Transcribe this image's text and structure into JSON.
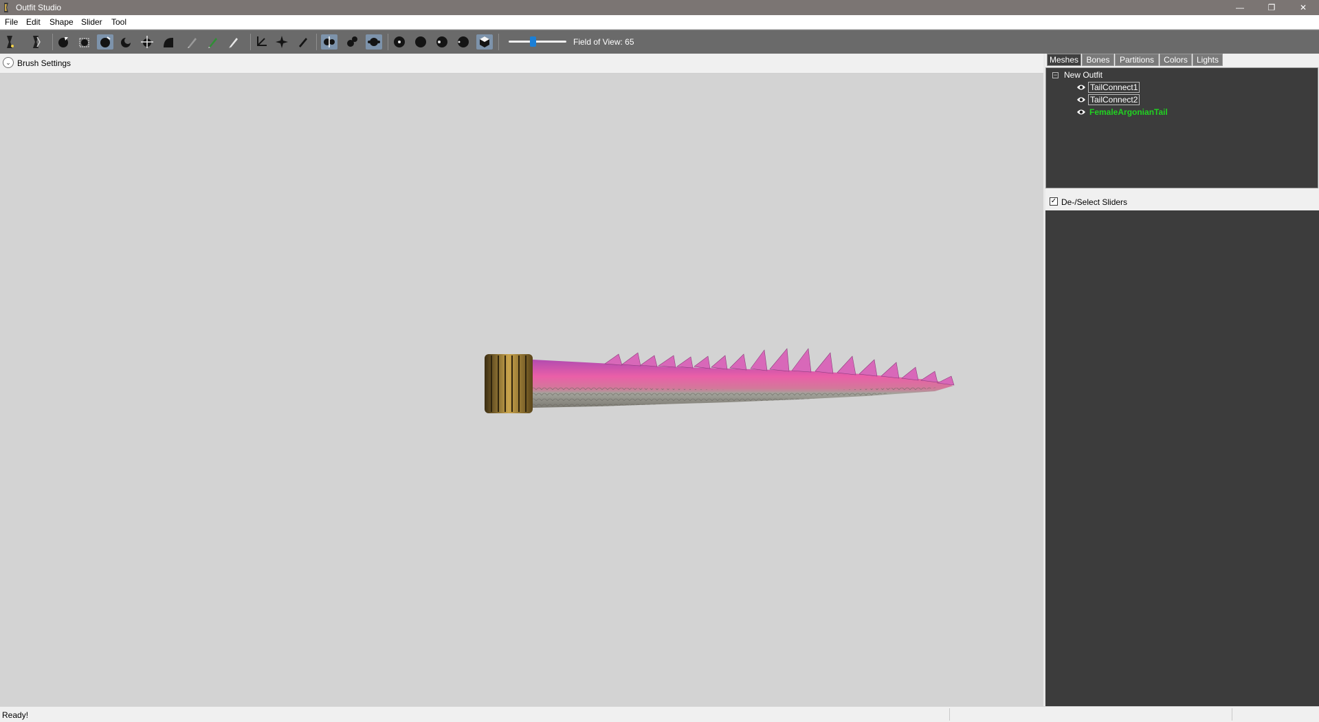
{
  "window": {
    "title": "Outfit Studio",
    "minimize": "—",
    "maximize": "❐",
    "close": "✕"
  },
  "menu": [
    "File",
    "Edit",
    "Shape",
    "Slider",
    "Tool"
  ],
  "toolbar": {
    "field_of_view_label": "Field of View: 65",
    "field_of_view_value": 65,
    "tools": [
      {
        "name": "reference-tool-icon",
        "glyph": "⟩"
      },
      {
        "name": "outfit-tool-icon",
        "glyph": "⟩"
      },
      {
        "name": "select-brush-icon",
        "glyph": "●"
      },
      {
        "name": "mask-brush-icon",
        "glyph": "▦"
      },
      {
        "name": "inflate-brush-icon",
        "glyph": "●"
      },
      {
        "name": "deflate-brush-icon",
        "glyph": "◖"
      },
      {
        "name": "move-brush-icon",
        "glyph": "✥"
      },
      {
        "name": "smooth-brush-icon",
        "glyph": "◗"
      },
      {
        "name": "weight-brush-icon",
        "glyph": "✎"
      },
      {
        "name": "color-brush-icon",
        "glyph": "✎"
      },
      {
        "name": "alpha-brush-icon",
        "glyph": "✎"
      },
      {
        "name": "transform-icon",
        "glyph": "⊾"
      },
      {
        "name": "pivot-icon",
        "glyph": "✦"
      },
      {
        "name": "vertex-edit-icon",
        "glyph": "✐"
      },
      {
        "name": "x-mirror-icon",
        "glyph": "◐"
      },
      {
        "name": "connected-only-icon",
        "glyph": "⚈"
      },
      {
        "name": "global-brush-icon",
        "glyph": "⦿"
      },
      {
        "name": "brush-size-1-icon",
        "glyph": "●"
      },
      {
        "name": "brush-size-2-icon",
        "glyph": "⬤"
      },
      {
        "name": "brush-size-3-icon",
        "glyph": "◕"
      },
      {
        "name": "brush-size-4-icon",
        "glyph": "◉"
      },
      {
        "name": "view-mode-icon",
        "glyph": "◆"
      }
    ]
  },
  "viewport": {
    "brush_settings_label": "Brush Settings",
    "expand_glyph": "⌄"
  },
  "panel": {
    "tabs": [
      "Meshes",
      "Bones",
      "Partitions",
      "Colors",
      "Lights"
    ],
    "tree_root": "New Outfit",
    "toggle_glyph": "−",
    "meshes": [
      "TailConnect1",
      "TailConnect2",
      "FemaleArgonianTail"
    ],
    "sliders_label": "De-/Select Sliders",
    "sliders_checked": "✓"
  },
  "status": {
    "text": "Ready!"
  },
  "colors": {
    "active_mesh": "#21d321",
    "toolbar_bg": "#6a6a6a",
    "panel_bg": "#3c3c3c"
  }
}
